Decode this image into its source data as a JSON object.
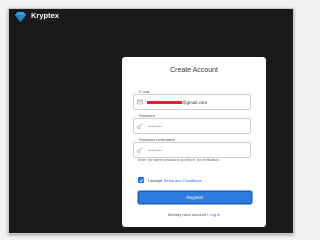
{
  "brand": {
    "name": "Kryptex",
    "logo_icon": "diamond-logo-icon",
    "accent": "#29a3f0"
  },
  "card": {
    "title": "Create Account",
    "email": {
      "label": "E-mail",
      "value_suffix": "@gmail.com",
      "icon": "mail-icon"
    },
    "password": {
      "label": "Password",
      "masked": "••••••••",
      "icon": "key-icon"
    },
    "password_confirm": {
      "label": "Password confirmation",
      "masked": "••••••••",
      "icon": "key-icon"
    },
    "hint": "Enter the same password as before, for verification.",
    "terms": {
      "checked": true,
      "prefix": "I accept ",
      "link": "Terms and Conditions"
    },
    "register_button": "Register",
    "login_prompt": {
      "prefix": "Already have account? ",
      "link": "Log in"
    }
  },
  "colors": {
    "background": "#1a1a1a",
    "card": "#ffffff",
    "primary": "#2d7be0",
    "redaction": "#e8212b"
  }
}
